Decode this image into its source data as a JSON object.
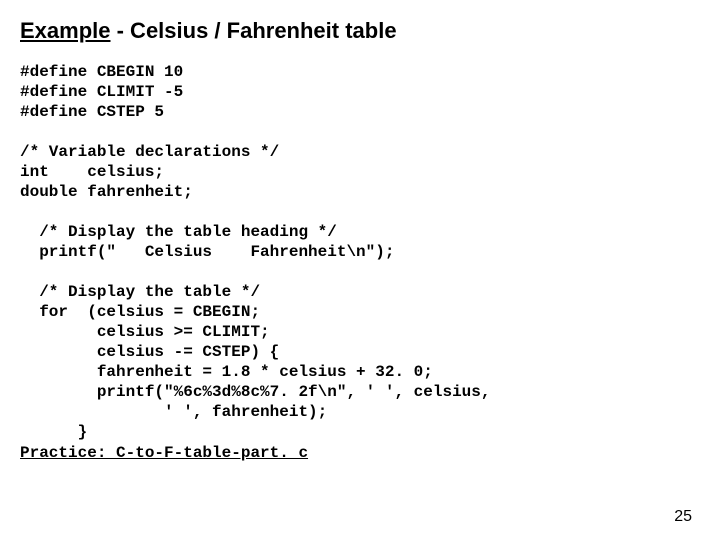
{
  "title": {
    "underlined": "Example",
    "rest": " - Celsius / Fahrenheit table"
  },
  "code": {
    "l01": "#define CBEGIN 10",
    "l02": "#define CLIMIT -5",
    "l03": "#define CSTEP 5",
    "l04": "",
    "l05": "/* Variable declarations */",
    "l06": "int    celsius;",
    "l07": "double fahrenheit;",
    "l08": "",
    "l09": "  /* Display the table heading */",
    "l10": "  printf(\"   Celsius    Fahrenheit\\n\");",
    "l11": "",
    "l12": "  /* Display the table */",
    "l13": "  for  (celsius = CBEGIN;",
    "l14": "        celsius >= CLIMIT;",
    "l15": "        celsius -= CSTEP) {",
    "l16": "        fahrenheit = 1.8 * celsius + 32. 0;",
    "l17": "        printf(\"%6c%3d%8c%7. 2f\\n\", ' ', celsius,",
    "l18": "               ' ', fahrenheit);",
    "l19": "      }"
  },
  "practice": "Practice: C-to-F-table-part. c",
  "page_number": "25"
}
